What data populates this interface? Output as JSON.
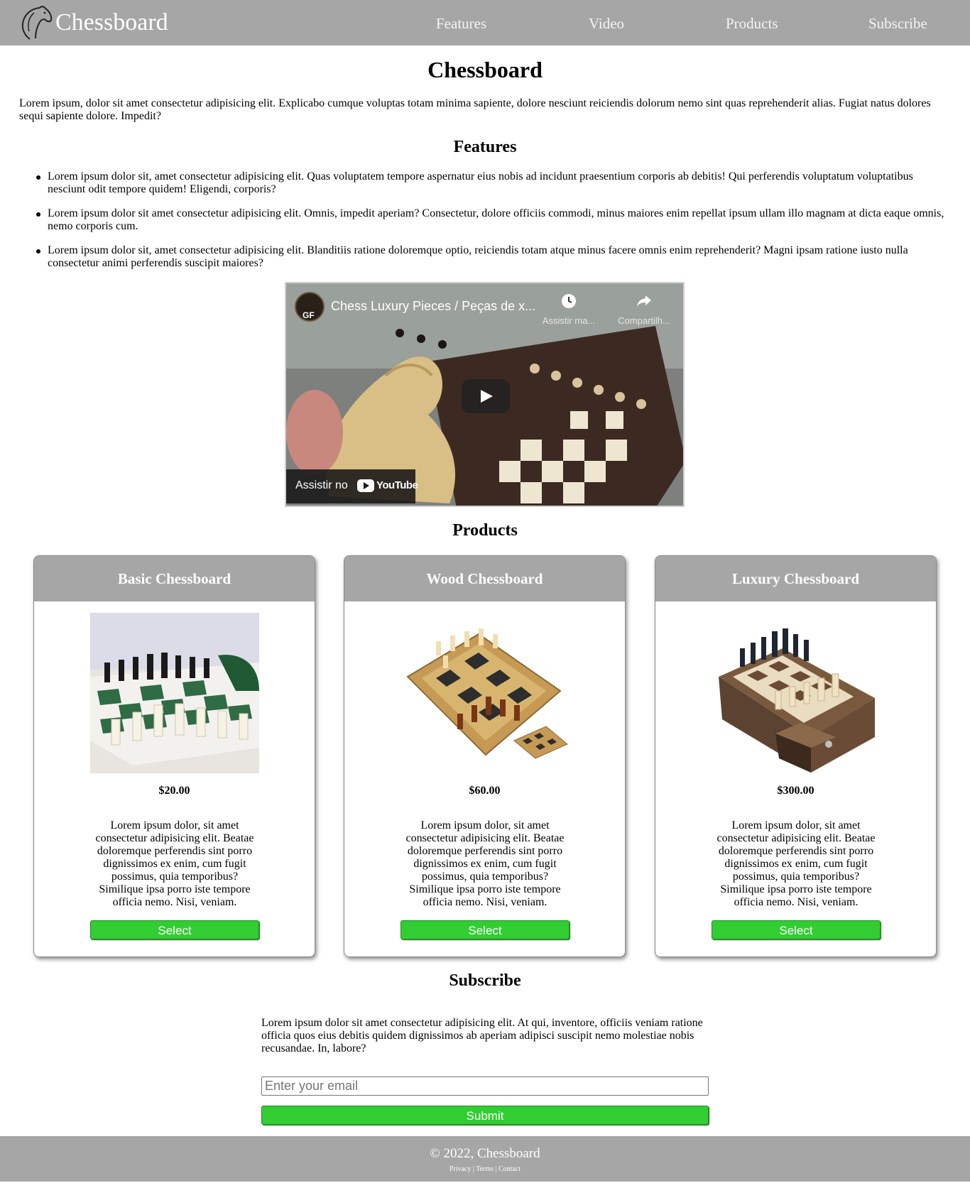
{
  "header": {
    "logo_text": "Chessboard",
    "nav": [
      "Features",
      "Video",
      "Products",
      "Subscribe"
    ]
  },
  "main": {
    "title": "Chessboard",
    "intro": "Lorem ipsum, dolor sit amet consectetur adipisicing elit. Explicabo cumque voluptas totam minima sapiente, dolore nesciunt reiciendis dolorum nemo sint quas reprehenderit alias. Fugiat natus dolores sequi sapiente dolore. Impedit?"
  },
  "features": {
    "heading": "Features",
    "items": [
      "Lorem ipsum dolor sit, amet consectetur adipisicing elit. Quas voluptatem tempore aspernatur eius nobis ad incidunt praesentium corporis ab debitis! Qui perferendis voluptatum voluptatibus nesciunt odit tempore quidem! Eligendi, corporis?",
      "Lorem ipsum dolor sit amet consectetur adipisicing elit. Omnis, impedit aperiam? Consectetur, dolore officiis commodi, minus maiores enim repellat ipsum ullam illo magnam at dicta eaque omnis, nemo corporis cum.",
      "Lorem ipsum dolor sit, amet consectetur adipisicing elit. Blanditiis ratione doloremque optio, reiciendis totam atque minus facere omnis enim reprehenderit? Magni ipsam ratione iusto nulla consectetur animi perferendis suscipit maiores?"
    ]
  },
  "video": {
    "channel_avatar": "GF",
    "title": "Chess Luxury Pieces / Peças de x...",
    "watch_later_label": "Assistir ma...",
    "share_label": "Compartilh...",
    "watch_on_label": "Assistir no",
    "youtube_label": "YouTube",
    "icons": [
      "clock-icon",
      "share-icon",
      "play-icon",
      "youtube-logo-icon"
    ]
  },
  "products": {
    "heading": "Products",
    "items": [
      {
        "name": "Basic Chessboard",
        "price": "$20.00",
        "description": "Lorem ipsum dolor, sit amet consectetur adipisicing elit. Beatae doloremque perferendis sint porro dignissimos ex enim, cum fugit possimus, quia temporibus? Similique ipsa porro iste tempore officia nemo. Nisi, veniam.",
        "button": "Select"
      },
      {
        "name": "Wood Chessboard",
        "price": "$60.00",
        "description": "Lorem ipsum dolor, sit amet consectetur adipisicing elit. Beatae doloremque perferendis sint porro dignissimos ex enim, cum fugit possimus, quia temporibus? Similique ipsa porro iste tempore officia nemo. Nisi, veniam.",
        "button": "Select"
      },
      {
        "name": "Luxury Chessboard",
        "price": "$300.00",
        "description": "Lorem ipsum dolor, sit amet consectetur adipisicing elit. Beatae doloremque perferendis sint porro dignissimos ex enim, cum fugit possimus, quia temporibus? Similique ipsa porro iste tempore officia nemo. Nisi, veniam.",
        "button": "Select"
      }
    ]
  },
  "subscribe": {
    "heading": "Subscribe",
    "text": "Lorem ipsum dolor sit amet consectetur adipisicing elit. At qui, inventore, officiis veniam ratione officia quos eius debitis quidem dignissimos ab aperiam adipisci suscipit nemo molestiae nobis recusandae. In, labore?",
    "email_placeholder": "Enter your email",
    "submit_label": "Submit"
  },
  "footer": {
    "copyright": "© 2022, Chessboard",
    "links": [
      "Privacy",
      "Terms",
      "Contact"
    ],
    "separator": " | "
  },
  "colors": {
    "header_bg": "#a6a6a6",
    "button_green": "#32cd32",
    "footer_bg": "#a6a6a6"
  }
}
